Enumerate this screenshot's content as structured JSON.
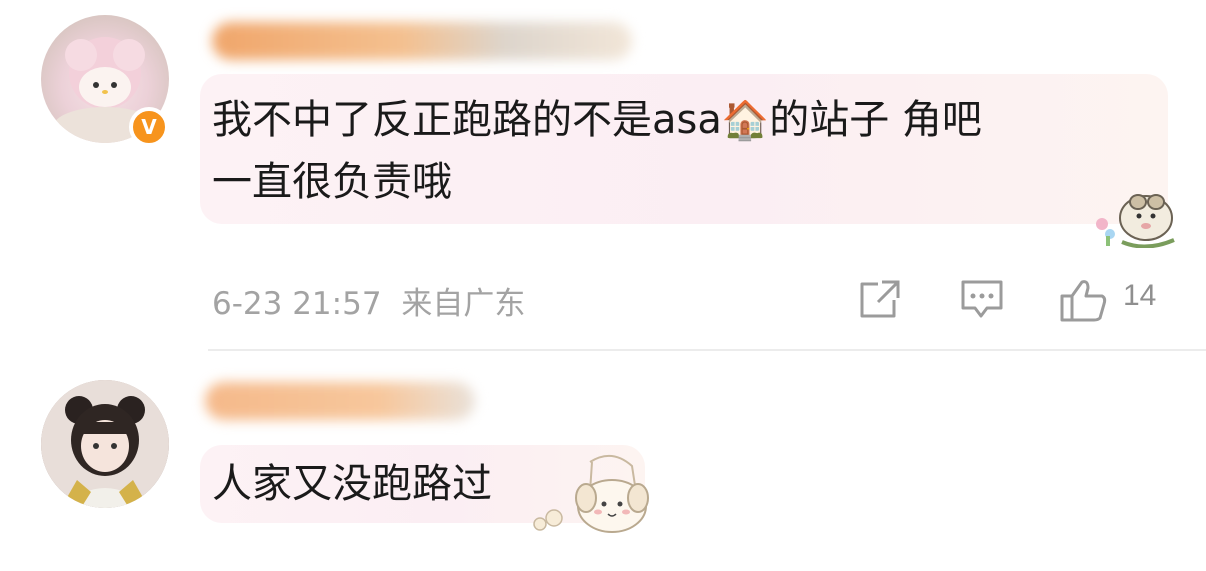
{
  "comments": [
    {
      "text_line1": "我不中了反正跑路的不是asa",
      "house_icon": "🏠",
      "text_line1_tail": "的站子 角吧",
      "text_line2": "一直很负责哦",
      "verified_badge": "V",
      "time": "6-23 21:57",
      "location": "来自广东",
      "likes": "14"
    },
    {
      "text": "人家又没跑路过"
    }
  ],
  "icons": {
    "share": "share-icon",
    "comment": "comment-icon",
    "like": "thumbs-up-icon",
    "verified": "verified-badge-icon"
  },
  "colors": {
    "text": "#1a1a1a",
    "meta": "#a3a3a3",
    "verified": "#f7941d",
    "bubble": "#fbeef3"
  }
}
